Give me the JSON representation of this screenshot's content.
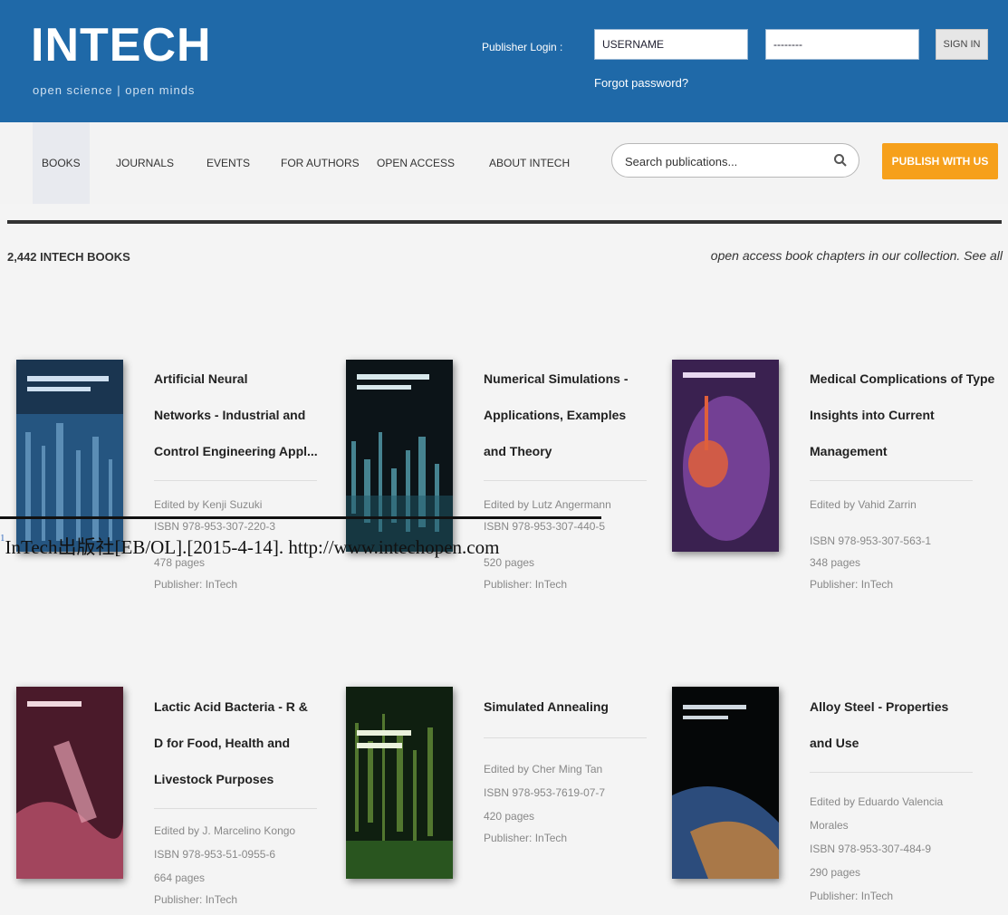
{
  "header": {
    "logo": "INTECH",
    "tagline": "open science | open minds",
    "login_label": "Publisher Login :",
    "username_value": "USERNAME",
    "password_value": "--------",
    "login_button": "SIGN IN",
    "forgot_password": "Forgot password?"
  },
  "nav": {
    "items": [
      {
        "label": "BOOKS"
      },
      {
        "label": "JOURNALS"
      },
      {
        "label": "EVENTS"
      },
      {
        "label": "FOR AUTHORS"
      },
      {
        "label": "OPEN ACCESS"
      },
      {
        "label": "ABOUT INTECH"
      }
    ],
    "search_placeholder": "Search publications...",
    "publish_button": "PUBLISH WITH US"
  },
  "listing": {
    "book_count": "2,442 INTECH BOOKS",
    "collection_note": "open access book chapters in our collection. See all"
  },
  "books": [
    {
      "title_lines": [
        "Artificial Neural",
        "Networks - Industrial and",
        "Control Engineering Appl..."
      ],
      "meta_lines": [
        "Edited by Kenji Suzuki",
        "ISBN 978-953-307-220-3",
        "478 pages",
        "Publisher: InTech"
      ],
      "cover_colors": [
        "#1a3550",
        "#2f6fa8",
        "#7fb3d9"
      ]
    },
    {
      "title_lines": [
        "Numerical Simulations -",
        "Applications, Examples",
        "and Theory"
      ],
      "meta_lines": [
        "Edited by Lutz Angermann",
        "ISBN 978-953-307-440-5",
        "520 pages",
        "Publisher: InTech"
      ],
      "cover_colors": [
        "#0c1418",
        "#1f5a6a",
        "#5fb3c4"
      ]
    },
    {
      "title_lines": [
        "Medical Complications of Type",
        "Insights into Current",
        "Management"
      ],
      "meta_lines": [
        "Edited by Vahid Zarrin",
        "ISBN 978-953-307-563-1",
        "348 pages",
        "Publisher: InTech"
      ],
      "cover_colors": [
        "#3a2150",
        "#8b4fb0",
        "#e0603a"
      ]
    },
    {
      "title_lines": [
        "Lactic Acid Bacteria - R &",
        "D for Food, Health and",
        "Livestock Purposes"
      ],
      "meta_lines": [
        "Edited by J. Marcelino Kongo",
        "ISBN 978-953-51-0955-6",
        "664 pages",
        "Publisher: InTech"
      ],
      "cover_colors": [
        "#4a1a2a",
        "#b8506a",
        "#e4a0b0"
      ]
    },
    {
      "title_lines": [
        "Simulated Annealing"
      ],
      "meta_lines": [
        "Edited by Cher Ming Tan",
        "ISBN 978-953-7619-07-7",
        "420 pages",
        "Publisher: InTech"
      ],
      "cover_colors": [
        "#0f1f10",
        "#3a7a2a",
        "#8ac04a"
      ]
    },
    {
      "title_lines": [
        "Alloy Steel - Properties",
        "and Use"
      ],
      "meta_lines": [
        "Edited by Eduardo Valencia",
        "Morales",
        "ISBN 978-953-307-484-9",
        "290 pages",
        "Publisher: InTech"
      ],
      "cover_colors": [
        "#050708",
        "#2c4c7c",
        "#c08040"
      ]
    }
  ],
  "footnote": {
    "marker": "1",
    "text": "InTech出版社[EB/OL].[2015-4-14]. http://www.intechopen.com"
  }
}
